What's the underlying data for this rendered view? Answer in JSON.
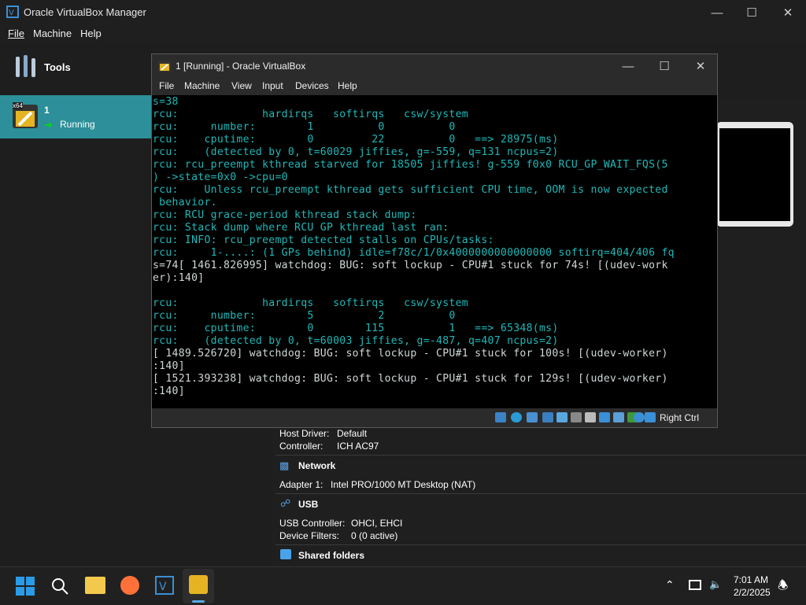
{
  "manager": {
    "title": "Oracle VirtualBox Manager",
    "menu": [
      "File",
      "Machine",
      "Help"
    ],
    "tools_label": "Tools",
    "vm": {
      "name": "1",
      "status": "Running",
      "badge": "x64"
    }
  },
  "details": {
    "audio": {
      "host_driver_label": "Host Driver:",
      "host_driver": "Default",
      "controller_label": "Controller:",
      "controller": "ICH AC97"
    },
    "network": {
      "header": "Network",
      "adapter_label": "Adapter 1:",
      "adapter": "Intel PRO/1000 MT Desktop (NAT)"
    },
    "usb": {
      "header": "USB",
      "controller_label": "USB Controller:",
      "controller": "OHCI, EHCI",
      "filters_label": "Device Filters:",
      "filters": "0 (0 active)"
    },
    "shared": {
      "header": "Shared folders"
    }
  },
  "vmwindow": {
    "title": "1 [Running] - Oracle VirtualBox",
    "menu": [
      "File",
      "Machine",
      "View",
      "Input",
      "Devices",
      "Help"
    ],
    "host_key": "Right Ctrl",
    "console": [
      "s=38",
      "rcu:             hardirqs   softirqs   csw/system",
      "rcu:     number:        1          0          0",
      "rcu:    cputime:        0         22          0   ==> 28975(ms)",
      "rcu:    (detected by 0, t=60029 jiffies, g=-559, q=131 ncpus=2)",
      "rcu: rcu_preempt kthread starved for 18505 jiffies! g-559 f0x0 RCU_GP_WAIT_FQS(5",
      ") ->state=0x0 ->cpu=0",
      "rcu:    Unless rcu_preempt kthread gets sufficient CPU time, OOM is now expected",
      " behavior.",
      "rcu: RCU grace-period kthread stack dump:",
      "rcu: Stack dump where RCU GP kthread last ran:",
      "rcu: INFO: rcu_preempt detected stalls on CPUs/tasks:",
      "rcu:     1-....: (1 GPs behind) idle=f78c/1/0x4000000000000000 softirq=404/406 fq",
      "s=74[ 1461.826995] watchdog: BUG: soft lockup - CPU#1 stuck for 74s! [(udev-work",
      "er):140]",
      "",
      "rcu:             hardirqs   softirqs   csw/system",
      "rcu:     number:        5          2          0",
      "rcu:    cputime:        0        115          1   ==> 65348(ms)",
      "rcu:    (detected by 0, t=60003 jiffies, g=-487, q=407 ncpus=2)",
      "[ 1489.526720] watchdog: BUG: soft lockup - CPU#1 stuck for 100s! [(udev-worker)",
      ":140]",
      "[ 1521.393238] watchdog: BUG: soft lockup - CPU#1 stuck for 129s! [(udev-worker)",
      ":140]"
    ]
  },
  "taskbar": {
    "time": "7:01 AM",
    "date": "2/2/2025"
  }
}
